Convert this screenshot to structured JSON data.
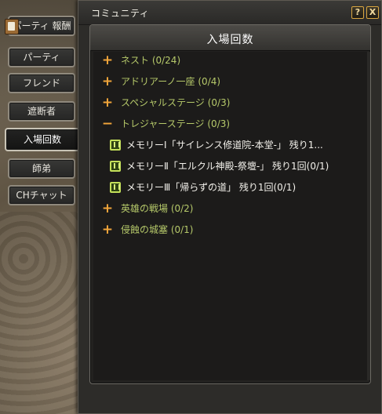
{
  "side_tabs": [
    {
      "label": "パーティ 報酬",
      "active": false,
      "icon": "reward-icon"
    },
    {
      "label": "パーティ",
      "active": false
    },
    {
      "label": "フレンド",
      "active": false
    },
    {
      "label": "遮断者",
      "active": false
    },
    {
      "label": "入場回数",
      "active": true
    },
    {
      "label": "師弟",
      "active": false
    },
    {
      "label": "CHチャット",
      "active": false
    }
  ],
  "window": {
    "title": "コミュニティ",
    "help_label": "?",
    "close_label": "X"
  },
  "panel": {
    "title": "入場回数"
  },
  "rows": [
    {
      "type": "category",
      "expander": "+",
      "label": "ネスト (0/24)"
    },
    {
      "type": "category",
      "expander": "+",
      "label": "アドリアーノ一座 (0/4)"
    },
    {
      "type": "category",
      "expander": "+",
      "label": "スペシャルステージ (0/3)"
    },
    {
      "type": "category",
      "expander": "−",
      "label": "トレジャーステージ (0/3)"
    },
    {
      "type": "item",
      "icon": "memory-icon",
      "label": "メモリーⅠ「サイレンス修道院-本堂-」 残り1..."
    },
    {
      "type": "item",
      "icon": "memory-icon",
      "label": "メモリーⅡ「エルクル神殿-祭壇-」 残り1回(0/1)"
    },
    {
      "type": "item",
      "icon": "memory-icon",
      "label": "メモリーⅢ「帰らずの道」 残り1回(0/1)"
    },
    {
      "type": "category",
      "expander": "+",
      "label": "英雄の戦場 (0/2)"
    },
    {
      "type": "category",
      "expander": "+",
      "label": "侵蝕の城塞 (0/1)"
    }
  ]
}
